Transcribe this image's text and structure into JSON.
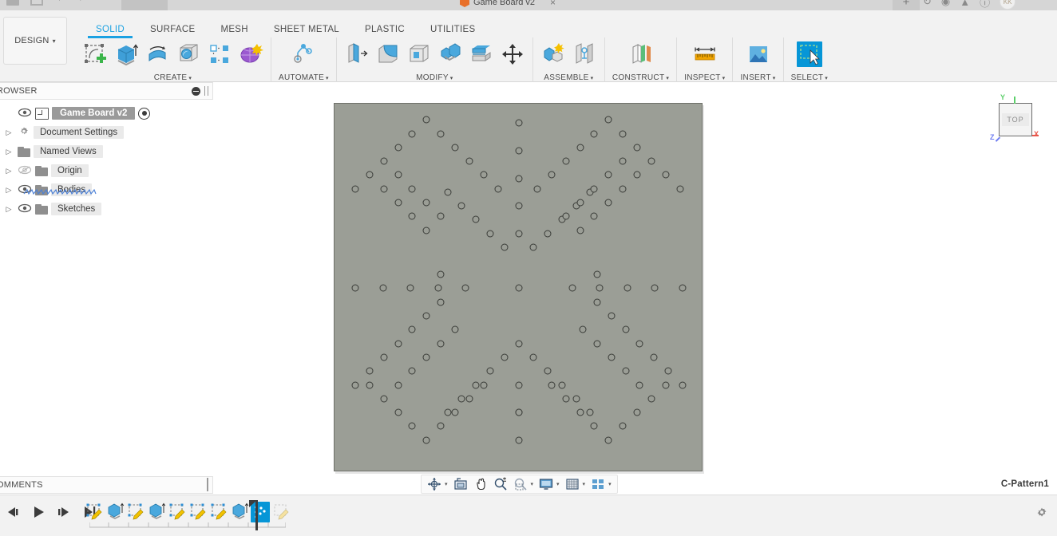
{
  "window": {
    "document_tab": "Game Board v2",
    "close_label": "×",
    "new_tab_label": "+",
    "avatar_initials": "KK"
  },
  "ribbon": {
    "workspace": "DESIGN",
    "workspace_caret": "▾",
    "tabs": [
      {
        "label": "SOLID",
        "active": true
      },
      {
        "label": "SURFACE",
        "active": false
      },
      {
        "label": "MESH",
        "active": false
      },
      {
        "label": "SHEET METAL",
        "active": false
      },
      {
        "label": "PLASTIC",
        "active": false
      },
      {
        "label": "UTILITIES",
        "active": false
      }
    ],
    "panels": [
      {
        "label": "CREATE",
        "caret": "▾",
        "icons": [
          "sketch-create-icon",
          "extrude-icon",
          "revolve-icon",
          "sphere-icon",
          "pattern-icon",
          "form-icon"
        ]
      },
      {
        "label": "AUTOMATE",
        "caret": "▾",
        "icons": [
          "automate-icon"
        ]
      },
      {
        "label": "MODIFY",
        "caret": "▾",
        "icons": [
          "press-pull-icon",
          "fillet-icon",
          "shell-icon",
          "combine-icon",
          "split-face-icon",
          "move-copy-icon"
        ]
      },
      {
        "label": "ASSEMBLE",
        "caret": "▾",
        "icons": [
          "new-component-icon",
          "joint-icon"
        ]
      },
      {
        "label": "CONSTRUCT",
        "caret": "▾",
        "icons": [
          "offset-plane-icon"
        ]
      },
      {
        "label": "INSPECT",
        "caret": "▾",
        "icons": [
          "measure-icon"
        ]
      },
      {
        "label": "INSERT",
        "caret": "▾",
        "icons": [
          "insert-image-icon"
        ]
      },
      {
        "label": "SELECT",
        "caret": "▾",
        "icons": [
          "select-window-icon"
        ]
      }
    ]
  },
  "browser": {
    "title": "ROWSER",
    "collapse_icon": "circle-minus-icon",
    "tree": [
      {
        "label": "Game Board v2",
        "kind": "root",
        "eye": true,
        "expand": ""
      },
      {
        "label": "Document Settings",
        "kind": "settings",
        "eye": false,
        "expand": "▷"
      },
      {
        "label": "Named Views",
        "kind": "folder",
        "eye": false,
        "expand": "▷"
      },
      {
        "label": "Origin",
        "kind": "folder",
        "eye": true,
        "eye_hidden": true,
        "expand": "▷"
      },
      {
        "label": "Bodies",
        "kind": "folder",
        "eye": true,
        "annotated": true,
        "expand": "▷"
      },
      {
        "label": "Sketches",
        "kind": "folder",
        "eye": true,
        "expand": "▷"
      }
    ]
  },
  "comments": {
    "title": "OMMENTS",
    "add_icon": "circle-plus-icon"
  },
  "viewcube": {
    "face_label": "TOP",
    "axis_x": "X",
    "axis_y": "Y",
    "axis_z": "Z",
    "color_x": "#e8564a",
    "color_y": "#5ccf6a",
    "color_z": "#6f7df0"
  },
  "navbar": {
    "items": [
      {
        "name": "orbit-icon",
        "caret": "▾"
      },
      {
        "name": "look-at-icon",
        "caret": ""
      },
      {
        "name": "pan-hand-icon",
        "caret": ""
      },
      {
        "name": "zoom-icon",
        "caret": ""
      },
      {
        "name": "zoom-window-icon",
        "caret": "▾"
      },
      {
        "name": "display-settings-icon",
        "caret": "▾"
      },
      {
        "name": "grid-snaps-icon",
        "caret": "▾"
      },
      {
        "name": "viewport-layout-icon",
        "caret": "▾"
      }
    ]
  },
  "status": {
    "feature_name": "C-Pattern1"
  },
  "timeline": {
    "playback": [
      "step-back-icon",
      "play-icon",
      "step-forward-icon",
      "go-to-end-icon"
    ],
    "features": [
      {
        "name": "sketch-feature",
        "type": "sketch",
        "active": false
      },
      {
        "name": "extrude-feature",
        "type": "extrude",
        "active": false
      },
      {
        "name": "sketch-feature",
        "type": "sketch",
        "active": false
      },
      {
        "name": "extrude-feature",
        "type": "extrude",
        "active": false
      },
      {
        "name": "sketch-feature",
        "type": "sketch",
        "active": false
      },
      {
        "name": "sketch-feature",
        "type": "sketch",
        "active": false
      },
      {
        "name": "sketch-feature",
        "type": "sketch",
        "active": false
      },
      {
        "name": "extrude-feature",
        "type": "extrude",
        "active": false
      },
      {
        "name": "circular-pattern-feature",
        "type": "pattern",
        "active": true
      },
      {
        "name": "sketch-feature",
        "type": "sketch",
        "active": false
      }
    ],
    "settings_icon": "gear-icon"
  },
  "model": {
    "board_color": "#9b9e96",
    "board_edge_color": "#6e7069",
    "hole_color": "#3a3c38",
    "board_size_px": 462,
    "hole_count": 121,
    "description": "Chinese-checkers style game board, top view",
    "holes": [
      [
        77.5,
        8.2
      ],
      [
        77.5,
        19.8
      ],
      [
        77.5,
        31.4
      ],
      [
        77.5,
        43.0
      ],
      [
        77.5,
        54.6
      ],
      [
        71.5,
        60.4
      ],
      [
        65.5,
        54.6
      ],
      [
        59.5,
        48.8
      ],
      [
        53.5,
        43.0
      ],
      [
        47.5,
        37.2
      ],
      [
        83.5,
        60.4
      ],
      [
        89.5,
        54.6
      ],
      [
        95.5,
        48.8
      ],
      [
        101.5,
        43.0
      ],
      [
        107.5,
        37.2
      ],
      [
        38.7,
        6.8
      ],
      [
        32.7,
        12.6
      ],
      [
        44.7,
        12.6
      ],
      [
        26.7,
        18.4
      ],
      [
        50.7,
        18.4
      ],
      [
        20.7,
        24.2
      ],
      [
        56.7,
        24.2
      ],
      [
        14.7,
        30.0
      ],
      [
        62.7,
        30.0
      ],
      [
        8.7,
        35.8
      ],
      [
        68.7,
        35.8
      ],
      [
        115.2,
        6.8
      ],
      [
        109.2,
        12.6
      ],
      [
        121.2,
        12.6
      ],
      [
        103.2,
        18.4
      ],
      [
        127.2,
        18.4
      ],
      [
        97.2,
        24.2
      ],
      [
        133.2,
        24.2
      ],
      [
        91.2,
        30.0
      ],
      [
        139.2,
        30.0
      ],
      [
        85.2,
        35.8
      ],
      [
        145.2,
        35.8
      ],
      [
        20.7,
        24.2
      ],
      [
        26.7,
        30.0
      ],
      [
        32.7,
        35.8
      ],
      [
        38.7,
        41.6
      ],
      [
        44.7,
        47.4
      ],
      [
        14.7,
        30.0
      ],
      [
        20.7,
        35.8
      ],
      [
        26.7,
        41.6
      ],
      [
        32.7,
        47.4
      ],
      [
        38.7,
        53.2
      ],
      [
        121.2,
        24.2
      ],
      [
        115.2,
        30.0
      ],
      [
        109.2,
        35.8
      ],
      [
        103.2,
        41.6
      ],
      [
        97.2,
        47.4
      ],
      [
        127.2,
        30.0
      ],
      [
        121.2,
        35.8
      ],
      [
        115.2,
        41.6
      ],
      [
        109.2,
        47.4
      ],
      [
        103.2,
        53.2
      ],
      [
        8.7,
        77.5
      ],
      [
        20.3,
        77.5
      ],
      [
        31.9,
        77.5
      ],
      [
        43.5,
        77.5
      ],
      [
        55.1,
        77.5
      ],
      [
        77.5,
        77.5
      ],
      [
        99.9,
        77.5
      ],
      [
        111.5,
        77.5
      ],
      [
        123.1,
        77.5
      ],
      [
        134.7,
        77.5
      ],
      [
        146.3,
        77.5
      ],
      [
        44.7,
        71.7
      ],
      [
        44.7,
        83.5
      ],
      [
        38.7,
        89.3
      ],
      [
        32.7,
        95.1
      ],
      [
        26.7,
        100.9
      ],
      [
        20.7,
        106.7
      ],
      [
        14.7,
        112.5
      ],
      [
        8.7,
        118.3
      ],
      [
        50.7,
        95.1
      ],
      [
        44.7,
        100.9
      ],
      [
        38.7,
        106.7
      ],
      [
        32.7,
        112.5
      ],
      [
        26.7,
        118.3
      ],
      [
        110.3,
        71.7
      ],
      [
        110.3,
        83.5
      ],
      [
        116.3,
        89.3
      ],
      [
        122.3,
        95.1
      ],
      [
        128.3,
        100.9
      ],
      [
        134.3,
        106.7
      ],
      [
        140.3,
        112.5
      ],
      [
        146.3,
        118.3
      ],
      [
        104.3,
        95.1
      ],
      [
        110.3,
        100.9
      ],
      [
        116.3,
        106.7
      ],
      [
        122.3,
        112.5
      ],
      [
        128.3,
        118.3
      ],
      [
        77.5,
        100.9
      ],
      [
        71.5,
        106.7
      ],
      [
        83.5,
        106.7
      ],
      [
        65.5,
        112.5
      ],
      [
        89.5,
        112.5
      ],
      [
        59.5,
        118.3
      ],
      [
        95.5,
        118.3
      ],
      [
        53.5,
        124.1
      ],
      [
        101.5,
        124.1
      ],
      [
        47.5,
        129.9
      ],
      [
        107.5,
        129.9
      ],
      [
        77.5,
        118.3
      ],
      [
        77.5,
        129.9
      ],
      [
        77.5,
        141.5
      ],
      [
        77.5,
        130.0
      ],
      [
        38.7,
        141.5
      ],
      [
        32.7,
        135.7
      ],
      [
        44.7,
        135.7
      ],
      [
        26.7,
        129.9
      ],
      [
        50.7,
        129.9
      ],
      [
        20.7,
        124.1
      ],
      [
        56.7,
        124.1
      ],
      [
        14.7,
        118.3
      ],
      [
        62.7,
        118.3
      ],
      [
        115.2,
        141.5
      ],
      [
        109.2,
        135.7
      ],
      [
        121.2,
        135.7
      ],
      [
        103.2,
        129.9
      ],
      [
        127.2,
        129.9
      ],
      [
        97.2,
        124.1
      ],
      [
        133.2,
        124.1
      ],
      [
        91.2,
        118.3
      ],
      [
        139.2,
        118.3
      ]
    ]
  }
}
